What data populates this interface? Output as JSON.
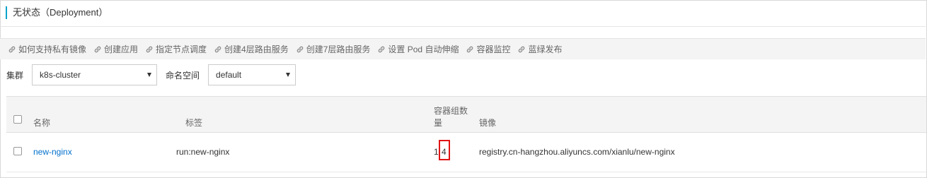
{
  "page": {
    "title": "无状态（Deployment）"
  },
  "links": [
    {
      "label": "如何支持私有镜像",
      "icon": "link-icon"
    },
    {
      "label": "创建应用",
      "icon": "link-icon"
    },
    {
      "label": "指定节点调度",
      "icon": "link-icon"
    },
    {
      "label": "创建4层路由服务",
      "icon": "link-icon"
    },
    {
      "label": "创建7层路由服务",
      "icon": "link-icon"
    },
    {
      "label": "设置 Pod 自动伸缩",
      "icon": "link-icon"
    },
    {
      "label": "容器监控",
      "icon": "link-icon"
    },
    {
      "label": "蓝绿发布",
      "icon": "link-icon"
    }
  ],
  "filters": {
    "cluster_label": "集群",
    "cluster_value": "k8s-cluster",
    "namespace_label": "命名空间",
    "namespace_value": "default"
  },
  "table": {
    "headers": {
      "name": "名称",
      "labels": "标签",
      "pod_count_line1": "容器组数",
      "pod_count_line2": "量",
      "image": "镜像"
    },
    "rows": [
      {
        "name": "new-nginx",
        "labels": "run:new-nginx",
        "pod_count_ready": "1",
        "pod_count_total": "4",
        "image": "registry.cn-hangzhou.aliyuncs.com/xianlu/new-nginx"
      }
    ]
  },
  "colors": {
    "accent": "#00a2ca",
    "link": "#0070cc",
    "highlight": "#e01515"
  }
}
